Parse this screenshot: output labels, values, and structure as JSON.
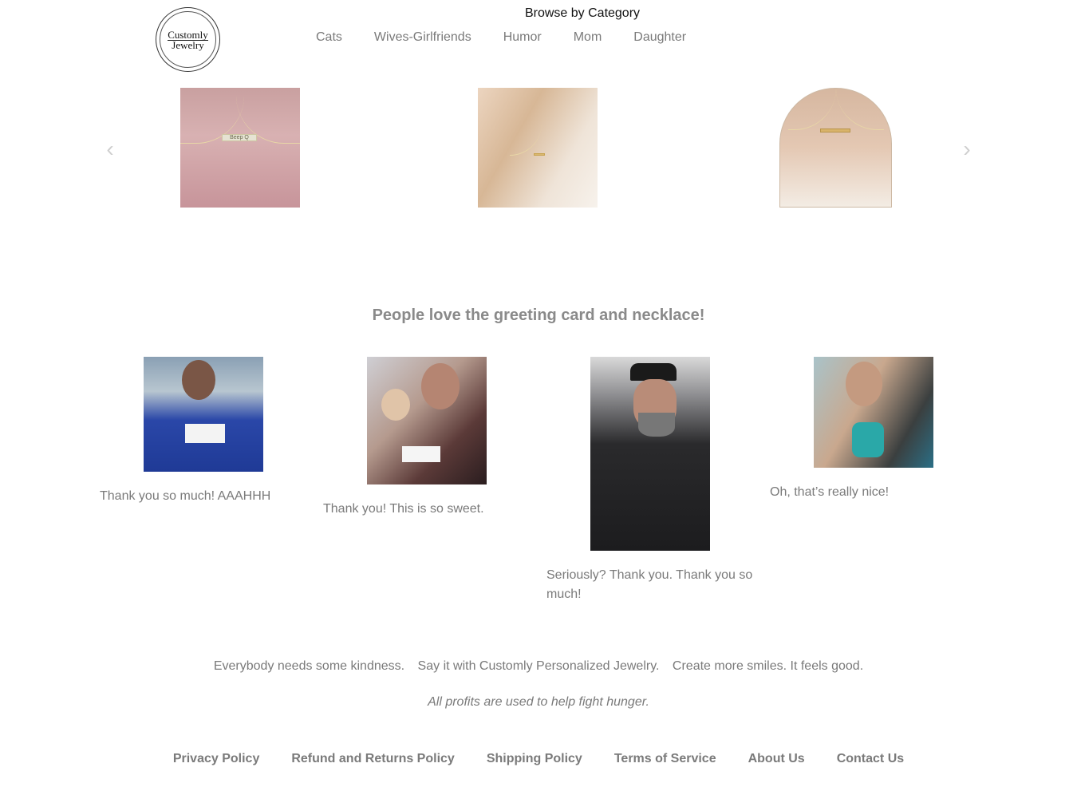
{
  "header": {
    "logo_line1": "Customly",
    "logo_line2": "Jewelry",
    "browse_title": "Browse by Category",
    "categories": [
      "Cats",
      "Wives-Girlfriends",
      "Humor",
      "Mom",
      "Daughter"
    ]
  },
  "carousel": {
    "prev_icon": "chevron-left-icon",
    "next_icon": "chevron-right-icon",
    "prev_glyph": "‹",
    "next_glyph": "›",
    "slide1_engraving": "Beep Q"
  },
  "testimonials": {
    "title": "People love the greeting card and necklace!",
    "quotes": [
      "Thank you so much! AAAHHH",
      "Thank you! This is so sweet.",
      "Seriously? Thank you. Thank you so much!",
      "Oh, that’s really nice!"
    ]
  },
  "tagline": {
    "part1": "Everybody needs some kindness.",
    "part2": "Say it with Customly Personalized Jewelry.",
    "part3": "Create more smiles. It feels good.",
    "profits": "All profits are used to help fight hunger."
  },
  "footer": {
    "links": [
      "Privacy Policy",
      "Refund and Returns Policy",
      "Shipping Policy",
      "Terms of Service",
      "About Us",
      "Contact Us"
    ]
  }
}
